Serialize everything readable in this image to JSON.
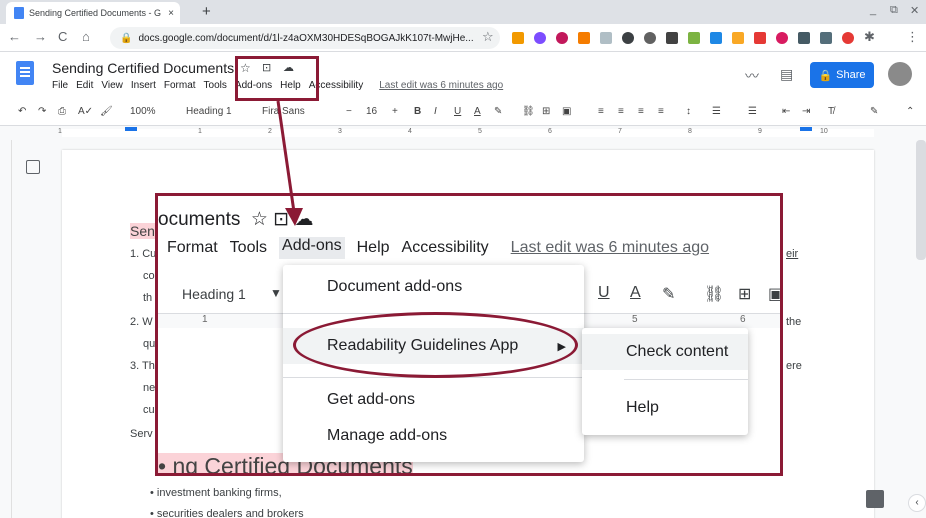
{
  "browser": {
    "tab_title": "Sending Certified Documents - G",
    "tab_close": "×",
    "new_tab": "+",
    "window_controls": [
      "_",
      "⧉",
      "✕"
    ],
    "nav": [
      "←",
      "→",
      "C",
      "⌂"
    ],
    "url": "docs.google.com/document/d/1l-z4aOXM30HDESqBOGAJkK107t-MwjHe..."
  },
  "docs": {
    "title": "Sending Certified Documents",
    "menu": [
      "File",
      "Edit",
      "View",
      "Insert",
      "Format",
      "Tools",
      "Add-ons",
      "Help",
      "Accessibility"
    ],
    "last_edit": "Last edit was 6 minutes ago",
    "share_label": "Share"
  },
  "toolbar": {
    "zoom": "100%",
    "style": "Heading 1",
    "font": "Fira Sans",
    "font_size": "16"
  },
  "ruler": {
    "marks": [
      "1",
      "1",
      "2",
      "3",
      "4",
      "5",
      "6",
      "7",
      "8",
      "9",
      "10"
    ]
  },
  "page": {
    "lines": [
      {
        "num": "1. ",
        "text": "Cu"
      },
      {
        "num": "",
        "text": "co"
      },
      {
        "num": "",
        "text": "th"
      },
      {
        "num": "2. ",
        "text": "W"
      },
      {
        "num": "",
        "text": "qu"
      },
      {
        "num": "3. ",
        "text": "Th"
      },
      {
        "num": "",
        "text": "ne"
      },
      {
        "num": "",
        "text": "cu"
      },
      {
        "num": "",
        "text": "Serv"
      }
    ],
    "right_words": [
      "eir",
      "the",
      "ere"
    ],
    "heading_partial": "Sen",
    "bullets": [
      "investment banking firms,",
      "securities dealers and brokers"
    ]
  },
  "zoom": {
    "title_partial": "ocuments",
    "menu": [
      "Format",
      "Tools",
      "Add-ons",
      "Help",
      "Accessibility"
    ],
    "last_edit": "Last edit was 6 minutes ago",
    "style": "Heading 1",
    "ruler_marks": [
      "1",
      "5",
      "6"
    ],
    "heading": "ng Certified Documents",
    "addons_menu": [
      "Document add-ons",
      "Readability Guidelines App",
      "Get add-ons",
      "Manage add-ons"
    ],
    "submenu": [
      "Check content",
      "Help"
    ]
  },
  "colors": {
    "annotation": "#8b1a35",
    "share": "#1a73e8",
    "docs_blue": "#4285f4"
  }
}
